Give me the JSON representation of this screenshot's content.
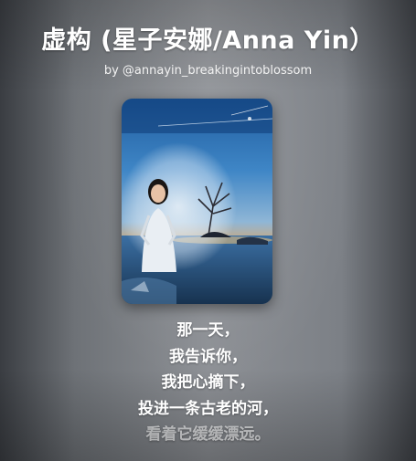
{
  "header": {
    "song_title": "虚构 (星子安娜/Anna Yin）",
    "byline": "by @annayin_breakingintoblossom"
  },
  "cover": {
    "description_icon": "album-cover-image"
  },
  "lyrics": [
    "那一天，",
    "我告诉你，",
    "我把心摘下，",
    "投进一条古老的河，",
    "看着它缓缓漂远。"
  ],
  "colors": {
    "text": "#ffffff",
    "background_center": "#8d9095",
    "background_edge": "#3a3d42"
  }
}
